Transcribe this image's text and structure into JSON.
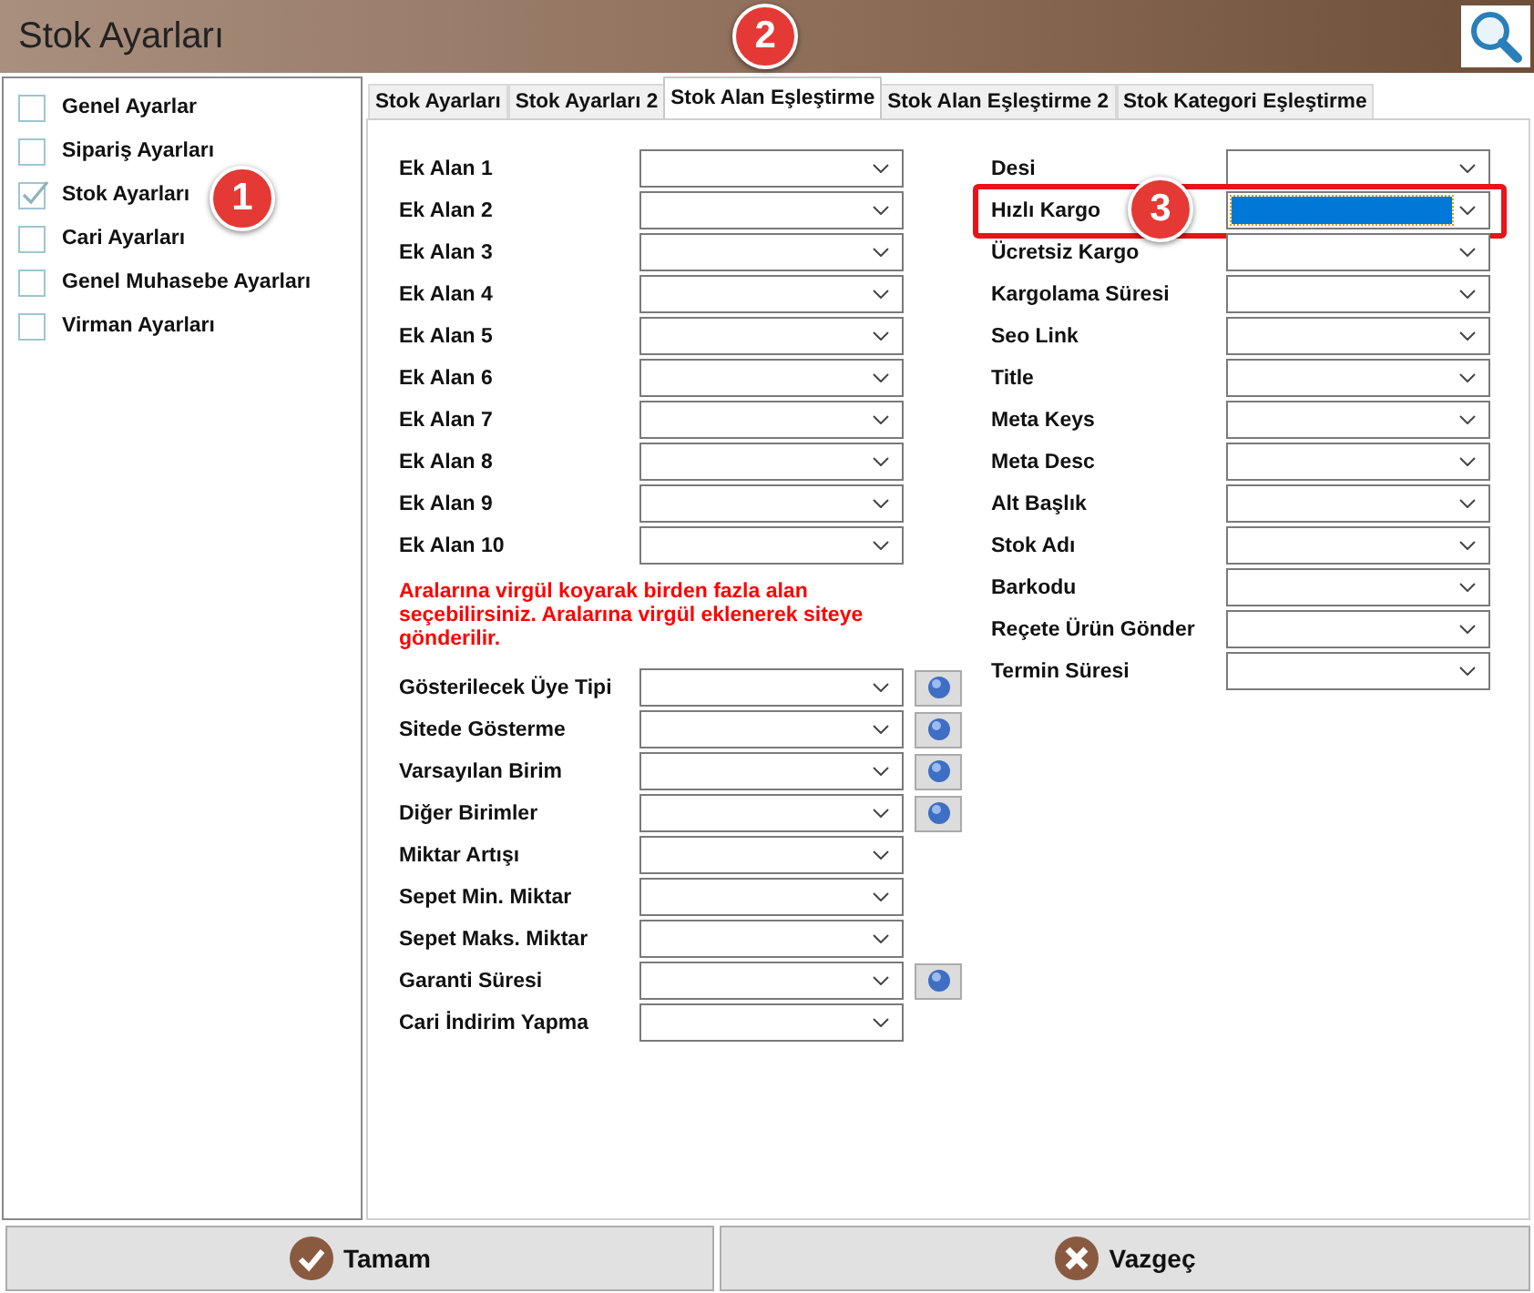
{
  "window": {
    "title": "Stok Ayarları"
  },
  "sidebar": {
    "items": [
      {
        "label": "Genel Ayarlar",
        "checked": false
      },
      {
        "label": "Sipariş Ayarları",
        "checked": false
      },
      {
        "label": "Stok Ayarları",
        "checked": true,
        "badge": "1"
      },
      {
        "label": "Cari Ayarları",
        "checked": false
      },
      {
        "label": "Genel Muhasebe Ayarları",
        "checked": false
      },
      {
        "label": "Virman Ayarları",
        "checked": false
      }
    ]
  },
  "tabs": [
    {
      "label": "Stok Ayarları",
      "selected": false
    },
    {
      "label": "Stok Ayarları 2",
      "selected": false
    },
    {
      "label": "Stok Alan Eşleştirme",
      "selected": true,
      "badge": "2"
    },
    {
      "label": "Stok Alan Eşleştirme 2",
      "selected": false
    },
    {
      "label": "Stok Kategori Eşleştirme",
      "selected": false
    }
  ],
  "left_fields": [
    {
      "label": "Ek Alan 1"
    },
    {
      "label": "Ek Alan 2"
    },
    {
      "label": "Ek Alan 3"
    },
    {
      "label": "Ek Alan 4"
    },
    {
      "label": "Ek Alan 5"
    },
    {
      "label": "Ek Alan 6"
    },
    {
      "label": "Ek Alan 7"
    },
    {
      "label": "Ek Alan 8"
    },
    {
      "label": "Ek Alan 9"
    },
    {
      "label": "Ek Alan 10"
    }
  ],
  "note": "Aralarına virgül koyarak birden fazla alan seçebilirsiniz. Aralarına virgül  eklenerek siteye gönderilir.",
  "lower_fields": [
    {
      "label": "Gösterilecek Üye Tipi",
      "help": true
    },
    {
      "label": "Sitede Gösterme",
      "help": true
    },
    {
      "label": "Varsayılan Birim",
      "help": true
    },
    {
      "label": "Diğer Birimler",
      "help": true
    },
    {
      "label": "Miktar Artışı",
      "help": false
    },
    {
      "label": "Sepet Min. Miktar",
      "help": false
    },
    {
      "label": "Sepet Maks. Miktar",
      "help": false
    },
    {
      "label": "Garanti Süresi",
      "help": true
    },
    {
      "label": "Cari İndirim Yapma",
      "help": false
    }
  ],
  "right_fields": [
    {
      "label": "Desi",
      "selected": false
    },
    {
      "label": "Hızlı Kargo",
      "selected": true,
      "badge": "3"
    },
    {
      "label": "Ücretsiz Kargo",
      "selected": false
    },
    {
      "label": "Kargolama Süresi",
      "selected": false
    },
    {
      "label": "Seo Link",
      "selected": false
    },
    {
      "label": "Title",
      "selected": false
    },
    {
      "label": "Meta Keys",
      "selected": false
    },
    {
      "label": "Meta Desc",
      "selected": false
    },
    {
      "label": "Alt Başlık",
      "selected": false
    },
    {
      "label": "Stok Adı",
      "selected": false
    },
    {
      "label": "Barkodu",
      "selected": false
    },
    {
      "label": "Reçete Ürün Gönder",
      "selected": false
    },
    {
      "label": "Termin Süresi",
      "selected": false
    }
  ],
  "buttons": [
    {
      "label": "Tamam",
      "kind": "ok"
    },
    {
      "label": "Vazgeç",
      "kind": "cancel"
    }
  ]
}
